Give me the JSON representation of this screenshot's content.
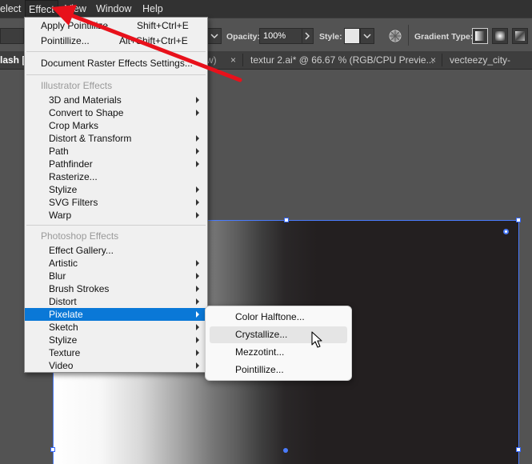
{
  "menubar": {
    "items": [
      {
        "label": "elect"
      },
      {
        "label": "Effect"
      },
      {
        "label": "View"
      },
      {
        "label": "Window"
      },
      {
        "label": "Help"
      }
    ]
  },
  "controlbar": {
    "opacity_label": "Opacity:",
    "opacity_value": "100%",
    "style_label": "Style:",
    "gradient_type_label": "Gradient Type:"
  },
  "tabs": [
    {
      "label": "lash [",
      "close": "w)"
    },
    {
      "label": "textur 2.ai* @ 66.67 % (RGB/CPU Previe...",
      "close": "×"
    },
    {
      "label": "vecteezy_city-skyline",
      "close": ""
    }
  ],
  "tab_close_symbol": "×",
  "effect_menu": {
    "apply_last": {
      "label": "Apply Pointillize",
      "shortcut": "Shift+Ctrl+E"
    },
    "last_effect": {
      "label": "Pointillize...",
      "shortcut": "Alt+Shift+Ctrl+E"
    },
    "doc_raster": {
      "label": "Document Raster Effects Settings..."
    },
    "illustrator_header": "Illustrator Effects",
    "illustrator_items": [
      {
        "label": "3D and Materials",
        "submenu": true
      },
      {
        "label": "Convert to Shape",
        "submenu": true
      },
      {
        "label": "Crop Marks",
        "submenu": false
      },
      {
        "label": "Distort & Transform",
        "submenu": true
      },
      {
        "label": "Path",
        "submenu": true
      },
      {
        "label": "Pathfinder",
        "submenu": true
      },
      {
        "label": "Rasterize...",
        "submenu": false
      },
      {
        "label": "Stylize",
        "submenu": true
      },
      {
        "label": "SVG Filters",
        "submenu": true
      },
      {
        "label": "Warp",
        "submenu": true
      }
    ],
    "photoshop_header": "Photoshop Effects",
    "photoshop_items": [
      {
        "label": "Effect Gallery...",
        "submenu": false
      },
      {
        "label": "Artistic",
        "submenu": true
      },
      {
        "label": "Blur",
        "submenu": true
      },
      {
        "label": "Brush Strokes",
        "submenu": true
      },
      {
        "label": "Distort",
        "submenu": true
      },
      {
        "label": "Pixelate",
        "submenu": true,
        "highlighted": true
      },
      {
        "label": "Sketch",
        "submenu": true
      },
      {
        "label": "Stylize",
        "submenu": true
      },
      {
        "label": "Texture",
        "submenu": true
      },
      {
        "label": "Video",
        "submenu": true
      }
    ]
  },
  "pixelate_submenu": {
    "items": [
      {
        "label": "Color Halftone..."
      },
      {
        "label": "Crystallize...",
        "hovered": true
      },
      {
        "label": "Mezzotint..."
      },
      {
        "label": "Pointillize..."
      }
    ]
  },
  "colors": {
    "highlight": "#0a78d7",
    "annotation_arrow": "#e8111b",
    "selection": "#4a7cff"
  }
}
